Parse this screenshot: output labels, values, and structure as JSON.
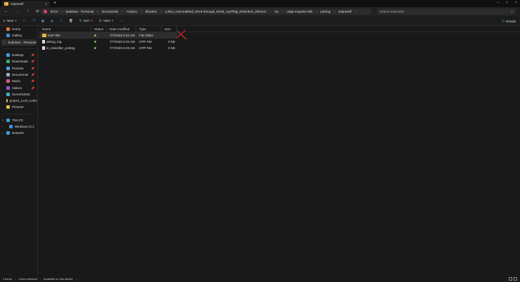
{
  "window": {
    "tab_title": "esprassif",
    "new_tab": "+",
    "close": "×",
    "controls": [
      "–",
      "□",
      "×"
    ]
  },
  "nav": {
    "back": "←",
    "forward": "→",
    "up": "↑",
    "refresh": "⟳"
  },
  "breadcrumb": [
    "Error",
    "kutluhan - Personal",
    "Documents",
    "Arduino",
    "libraries",
    "LoRa_LLM-enabled_Drive-through_Kiosk_AprilTag_Detection_inferenc",
    "src",
    "edge-impulse-sdk",
    "porting",
    "espressif"
  ],
  "search": {
    "placeholder": "Search espressif"
  },
  "toolbar": {
    "new": "New",
    "sort": "Sort",
    "view": "View",
    "more": "···",
    "details": "Details"
  },
  "sidebar": {
    "top": [
      {
        "label": "Home",
        "color": "#e0763a"
      },
      {
        "label": "Gallery",
        "color": "#3a8fe0"
      },
      {
        "label": "kutluhan - Personal",
        "color": "#2b7bd4"
      }
    ],
    "quick": [
      {
        "label": "Desktop",
        "color": "#3aa0d8"
      },
      {
        "label": "Downloads",
        "color": "#3ab06a"
      },
      {
        "label": "Pictures",
        "color": "#4a9ee0"
      },
      {
        "label": "Documents",
        "color": "#9aa8c0"
      },
      {
        "label": "Music",
        "color": "#e05a8a"
      },
      {
        "label": "Videos",
        "color": "#8a5ae0"
      },
      {
        "label": "Screenshots",
        "color": "#3ab0c0"
      },
      {
        "label": "project_LLM_LoRA",
        "color": "#e8b64a"
      },
      {
        "label": "Pictures",
        "color": "#e8b64a"
      }
    ],
    "devices": [
      {
        "label": "This PC",
        "color": "#3aa0d8"
      },
      {
        "label": "Windows (C:)",
        "color": "#3a8fe0"
      },
      {
        "label": "Network",
        "color": "#3aa0d8"
      }
    ]
  },
  "columns": [
    "Name",
    "Status",
    "Date modified",
    "Type",
    "Size"
  ],
  "files": [
    {
      "name": "ESP-IDF",
      "date": "7/7/2025 5:04 AM",
      "type": "File folder",
      "size": "",
      "kind": "folder"
    },
    {
      "name": "debug_log",
      "date": "7/7/2025 5:03 AM",
      "type": "CPP File",
      "size": "3 KB",
      "kind": "file"
    },
    {
      "name": "ei_classifier_porting",
      "date": "7/7/2025 5:03 AM",
      "type": "CPP File",
      "size": "3 KB",
      "kind": "file"
    }
  ],
  "status": {
    "items": "3 items",
    "selected": "1 item selected",
    "availability": "Available on this device"
  },
  "annotation_color": "#d42a2a"
}
